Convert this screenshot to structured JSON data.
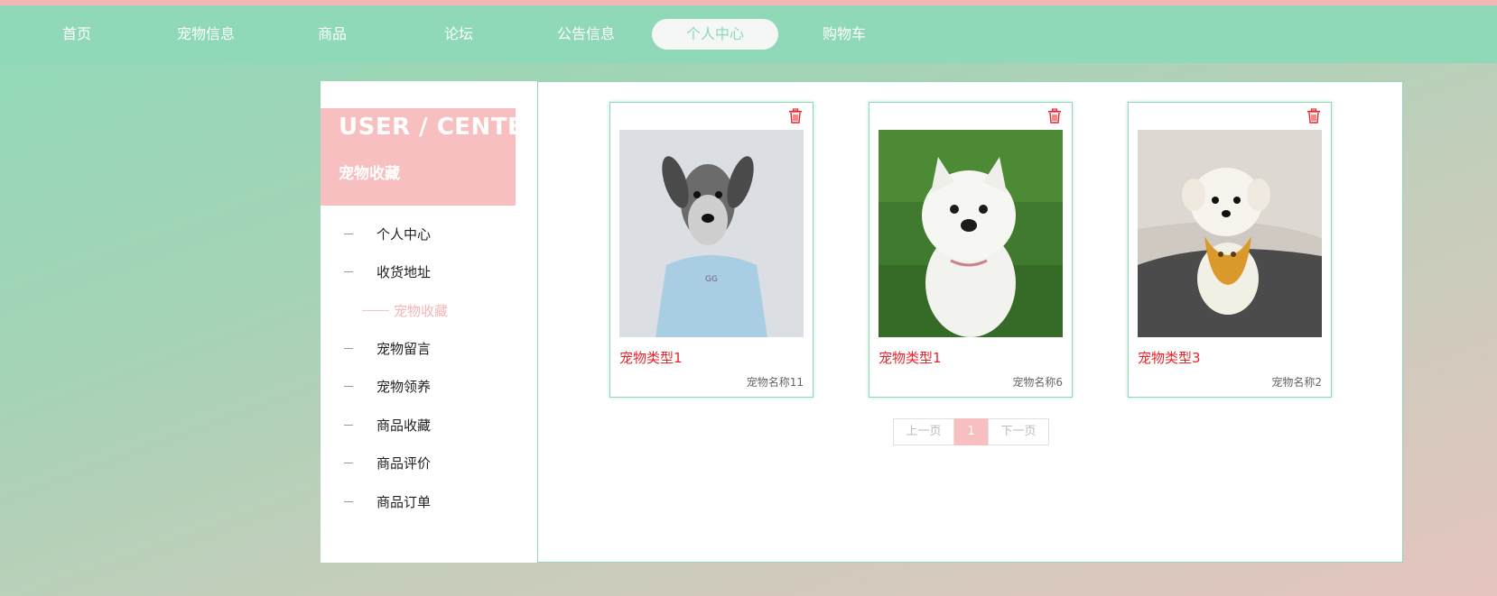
{
  "nav": {
    "items": [
      {
        "label": "首页"
      },
      {
        "label": "宠物信息"
      },
      {
        "label": "商品"
      },
      {
        "label": "论坛"
      },
      {
        "label": "公告信息"
      },
      {
        "label": "个人中心"
      },
      {
        "label": "购物车"
      }
    ],
    "active_index": 5
  },
  "sidebar": {
    "title": "USER / CENTER",
    "subtitle": "宠物收藏",
    "items": [
      {
        "label": "个人中心"
      },
      {
        "label": "收货地址"
      },
      {
        "label": "宠物收藏"
      },
      {
        "label": "宠物留言"
      },
      {
        "label": "宠物领养"
      },
      {
        "label": "商品收藏"
      },
      {
        "label": "商品评价"
      },
      {
        "label": "商品订单"
      }
    ],
    "active_index": 2
  },
  "cards": [
    {
      "type": "宠物类型1",
      "name": "宠物名称11",
      "image": "grey-schnauzer-in-blue-shirt"
    },
    {
      "type": "宠物类型1",
      "name": "宠物名称6",
      "image": "white-terrier-on-grass"
    },
    {
      "type": "宠物类型3",
      "name": "宠物名称2",
      "image": "white-puppy-with-yellow-bib"
    }
  ],
  "pager": {
    "prev": "上一页",
    "current": "1",
    "next": "下一页"
  },
  "icons": {
    "delete": "trash-icon"
  },
  "colors": {
    "accent": "#8fd9b8",
    "pink": "#f7bfbf",
    "type_red": "#e8242b"
  }
}
